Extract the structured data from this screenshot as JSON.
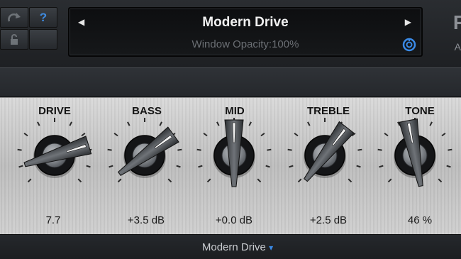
{
  "preset": {
    "name": "Modern Drive",
    "opacity_text": "Window Opacity:100%",
    "prev_arrow": "◀",
    "next_arrow": "▶"
  },
  "toolbar": {
    "help_label": "?",
    "icons": [
      "redo-icon",
      "help-icon",
      "lock-icon",
      "blank-button",
      "opacity-ring-icon"
    ]
  },
  "brand": {
    "glyph": "F",
    "glyph2": "A"
  },
  "knobs": [
    {
      "label": "DRIVE",
      "value": "7.7",
      "level": 0.77
    },
    {
      "label": "BASS",
      "value": "+3.5 dB",
      "level": 0.7
    },
    {
      "label": "MID",
      "value": "+0.0 dB",
      "level": 0.5
    },
    {
      "label": "TREBLE",
      "value": "+2.5 dB",
      "level": 0.64
    },
    {
      "label": "TONE",
      "value": "46 %",
      "level": 0.46
    }
  ],
  "footer": {
    "preset_menu": "Modern Drive",
    "menu_arrow": "▾"
  },
  "colors": {
    "accent": "#3a8ae6",
    "panel": "#cdcdcd",
    "background": "#1b1d20"
  }
}
